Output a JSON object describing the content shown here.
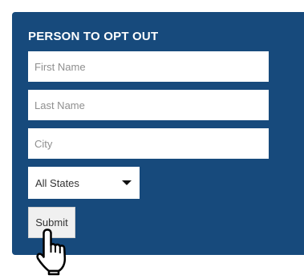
{
  "form": {
    "title": "PERSON TO OPT OUT",
    "first_name": {
      "placeholder": "First Name",
      "value": ""
    },
    "last_name": {
      "placeholder": "Last Name",
      "value": ""
    },
    "city": {
      "placeholder": "City",
      "value": ""
    },
    "state": {
      "selected": "All States"
    },
    "submit_label": "Submit"
  },
  "colors": {
    "panel": "#174a7c",
    "title": "#ffffff",
    "field_bg": "#ffffff",
    "button_bg": "#f0f0f0"
  },
  "cursor": {
    "icon": "hand-pointer-icon"
  }
}
